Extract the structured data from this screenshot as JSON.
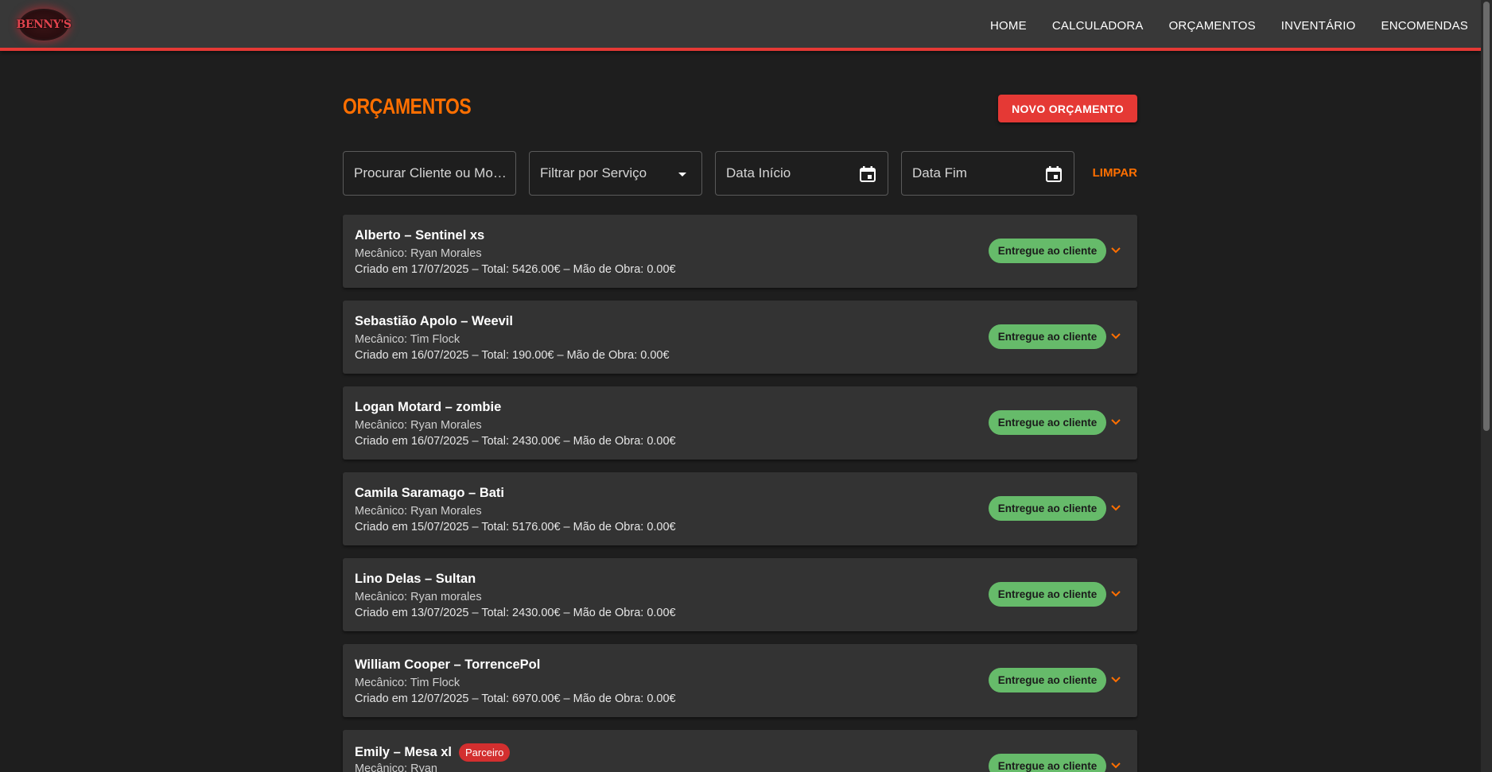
{
  "app": {
    "logo_text": "BENNY'S",
    "nav": [
      "HOME",
      "CALCULADORA",
      "ORÇAMENTOS",
      "INVENTÁRIO",
      "ENCOMENDAS"
    ]
  },
  "page": {
    "title": "ORÇAMENTOS",
    "new_button": "NOVO ORÇAMENTO"
  },
  "filters": {
    "search_placeholder": "Procurar Cliente ou Modelo",
    "service_placeholder": "Filtrar por Serviço",
    "start_date_label": "Data Início",
    "end_date_label": "Data Fim",
    "clear_label": "LIMPAR"
  },
  "quotes": [
    {
      "title": "Alberto – Sentinel xs",
      "mechanic": "Mecânico: Ryan Morales",
      "meta": "Criado em 17/07/2025 – Total: 5426.00€ – Mão de Obra: 0.00€",
      "status": "Entregue ao cliente",
      "badge": ""
    },
    {
      "title": "Sebastião Apolo – Weevil",
      "mechanic": "Mecânico: Tim Flock",
      "meta": "Criado em 16/07/2025 – Total: 190.00€ – Mão de Obra: 0.00€",
      "status": "Entregue ao cliente",
      "badge": ""
    },
    {
      "title": "Logan Motard – zombie",
      "mechanic": "Mecânico: Ryan Morales",
      "meta": "Criado em 16/07/2025 – Total: 2430.00€ – Mão de Obra: 0.00€",
      "status": "Entregue ao cliente",
      "badge": ""
    },
    {
      "title": "Camila Saramago – Bati",
      "mechanic": "Mecânico: Ryan Morales",
      "meta": "Criado em 15/07/2025 – Total: 5176.00€ – Mão de Obra: 0.00€",
      "status": "Entregue ao cliente",
      "badge": ""
    },
    {
      "title": "Lino Delas – Sultan",
      "mechanic": "Mecânico: Ryan morales",
      "meta": "Criado em 13/07/2025 – Total: 2430.00€ – Mão de Obra: 0.00€",
      "status": "Entregue ao cliente",
      "badge": ""
    },
    {
      "title": "William Cooper – TorrencePol",
      "mechanic": "Mecânico: Tim Flock",
      "meta": "Criado em 12/07/2025 – Total: 6970.00€ – Mão de Obra: 0.00€",
      "status": "Entregue ao cliente",
      "badge": ""
    },
    {
      "title": "Emily – Mesa xl",
      "mechanic": "Mecânico: Ryan",
      "meta": "",
      "status": "Entregue ao cliente",
      "badge": "Parceiro"
    }
  ],
  "colors": {
    "accent_orange": "#ff6f00",
    "accent_red": "#e53935",
    "status_green": "#66bb6a",
    "background": "#1e1e1e",
    "card": "#333333"
  }
}
